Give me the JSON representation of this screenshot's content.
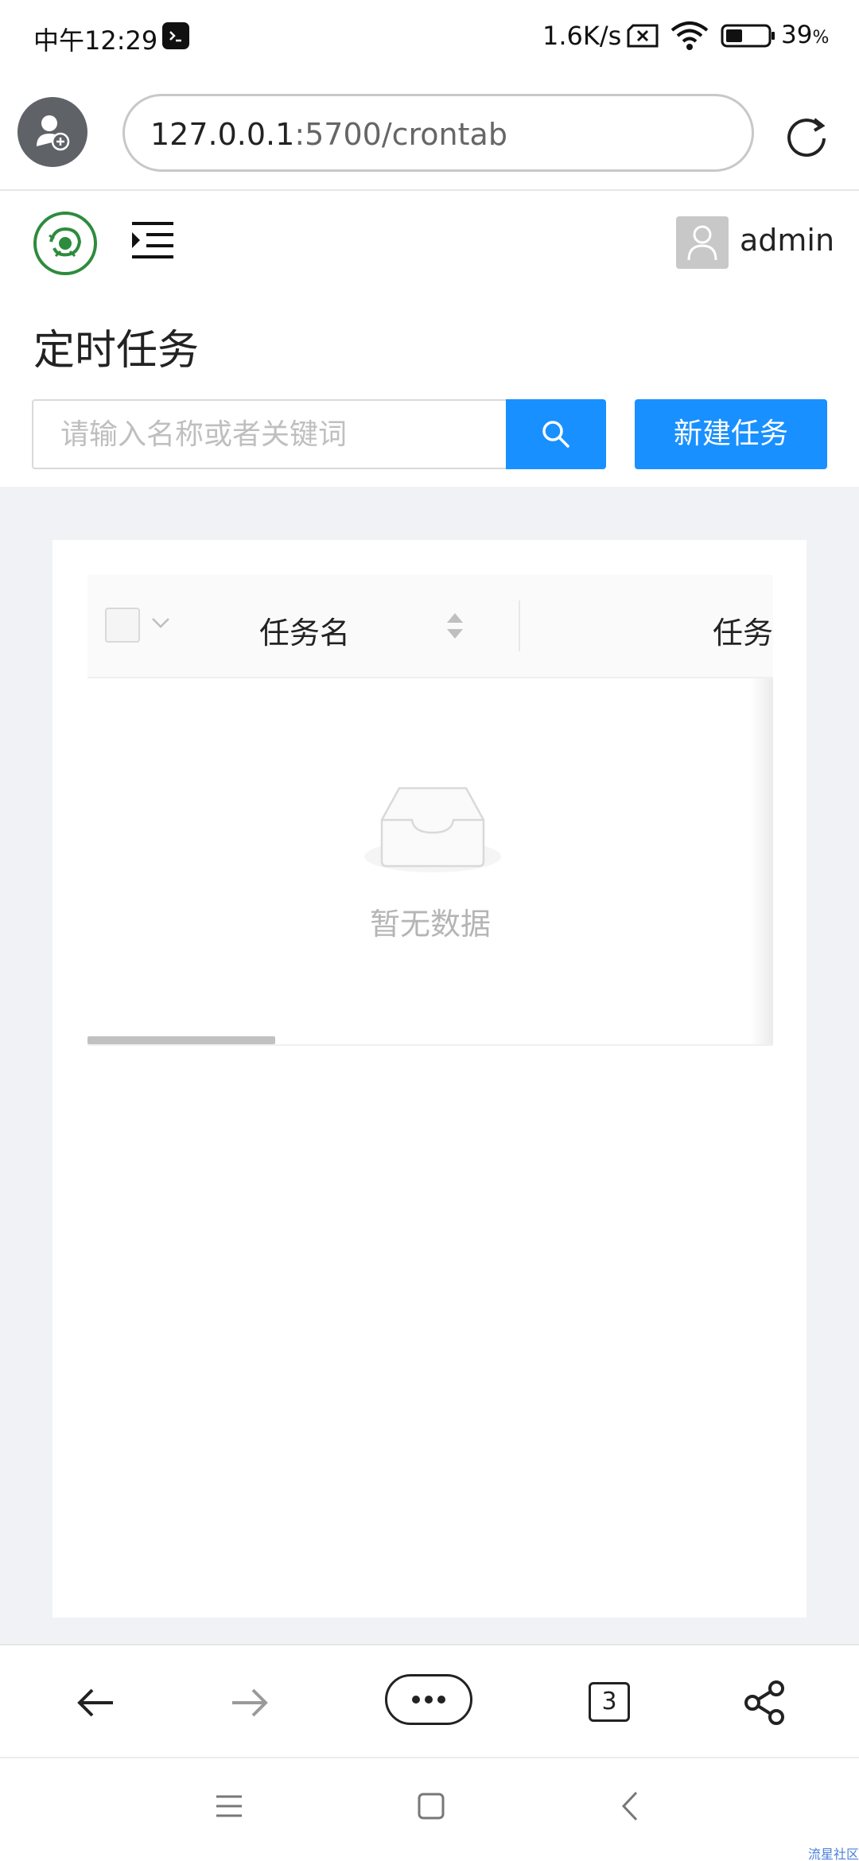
{
  "status_bar": {
    "time": "中午12:29",
    "network_speed": "1.6K/s",
    "battery_percent": "39",
    "battery_unit": "%",
    "icons": [
      "terminal-icon",
      "no-sim-icon",
      "wifi-icon",
      "battery-icon"
    ]
  },
  "browser": {
    "url_host": "127.0.0.1",
    "url_rest": ":5700/crontab",
    "open_tabs": "3",
    "icons": [
      "profile-icon",
      "reload-icon",
      "back-arrow-icon",
      "forward-arrow-icon",
      "more-menu-icon",
      "share-icon"
    ]
  },
  "app": {
    "user_name": "admin",
    "page_title": "定时任务",
    "search_placeholder": "请输入名称或者关键词",
    "new_task_label": "新建任务",
    "icons": [
      "logo-icon",
      "menu-fold-icon",
      "user-avatar-icon",
      "search-icon"
    ]
  },
  "table": {
    "columns": [
      "任务名",
      "任务"
    ],
    "empty_text": "暂无数据",
    "rows": []
  },
  "footer": {
    "watermark": "流星社区"
  },
  "colors": {
    "primary": "#1890ff",
    "page_bg": "#f0f2f5",
    "logo_green": "#2e8b3d"
  }
}
